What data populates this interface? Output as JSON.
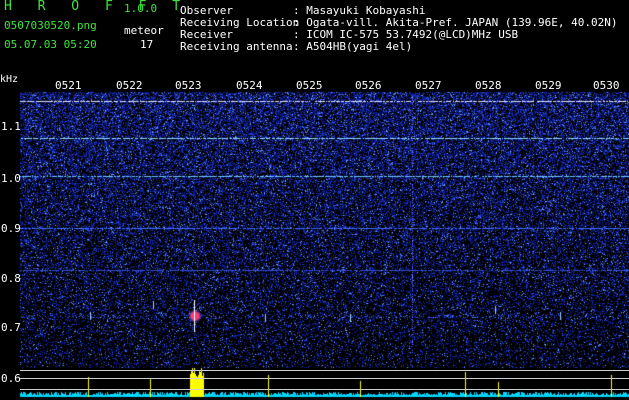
{
  "header": {
    "app_title": "H R O F F T",
    "app_version": "1.0.0",
    "filename": "0507030520.png",
    "timestamp": "05.07.03 05:20",
    "meteor_label": "meteor",
    "meteor_count": "17"
  },
  "info": {
    "rows": [
      {
        "label": "Observer",
        "value": ": Masayuki Kobayashi"
      },
      {
        "label": "Receiving Location",
        "value": ": Ogata-vill. Akita-Pref. JAPAN (139.96E, 40.02N)"
      },
      {
        "label": "Receiver",
        "value": ": ICOM IC-575 53.7492(@LCD)MHz USB"
      },
      {
        "label": "Receiving antenna",
        "value": ": A504HB(yagi 4el)"
      }
    ]
  },
  "spectrogram": {
    "freq_unit": "kHz",
    "freq_ticks": [
      "1.1",
      "1.0",
      "0.9",
      "0.8",
      "0.7",
      "0.6"
    ],
    "time_ticks": [
      "0521",
      "0522",
      "0523",
      "0524",
      "0525",
      "0526",
      "0527",
      "0528",
      "0529",
      "0530"
    ],
    "colors": {
      "background": "#000000",
      "noise_low": "#0a1a8c",
      "noise_high": "#4f7cff",
      "signal": "#ffffff",
      "echo": "#ff2a4d",
      "level": "#00e6ff",
      "level_peak": "#ffff00"
    }
  }
}
